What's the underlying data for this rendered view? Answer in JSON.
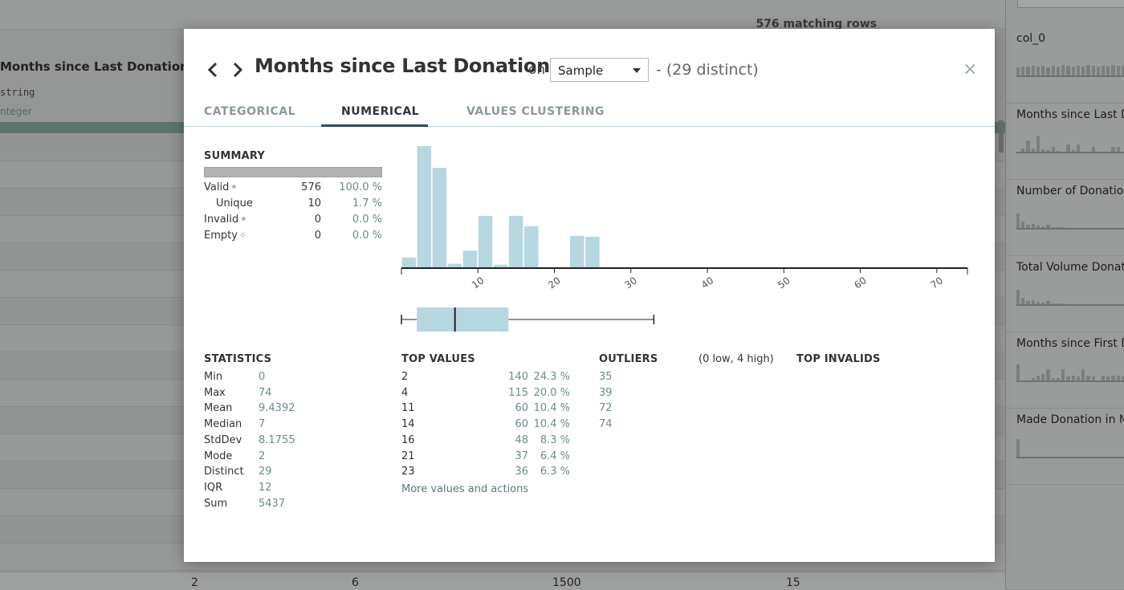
{
  "background": {
    "matching_rows": "576 matching rows",
    "column_header": "Months since Last Donation",
    "storage_type": "string",
    "meaning_type": "nteger",
    "bottom_row": [
      "2",
      "6",
      "1500",
      "15"
    ]
  },
  "side_panel": {
    "items": [
      {
        "label": "col_0",
        "bars": [
          10,
          11,
          11,
          12,
          11,
          12,
          10,
          12,
          11,
          13,
          12,
          11,
          12,
          11,
          13,
          12,
          11,
          12,
          11,
          13,
          12,
          12
        ]
      },
      {
        "label": "Months since Last D",
        "bars": [
          0,
          4,
          14,
          4,
          20,
          3,
          2,
          6,
          1,
          0,
          9,
          2,
          9,
          0,
          0,
          6,
          0,
          0,
          0,
          6,
          6,
          0
        ]
      },
      {
        "label": "Number of Donation",
        "bars": [
          18,
          8,
          4,
          5,
          3,
          2,
          4,
          1,
          1,
          1,
          0,
          0,
          0,
          0,
          0,
          0,
          0,
          0,
          0,
          0,
          0,
          0
        ]
      },
      {
        "label": "Total Volume Donate",
        "bars": [
          18,
          8,
          4,
          5,
          3,
          2,
          4,
          1,
          1,
          1,
          0,
          0,
          0,
          0,
          0,
          0,
          0,
          0,
          0,
          0,
          0,
          0
        ]
      },
      {
        "label": "Months since First D",
        "bars": [
          20,
          0,
          0,
          3,
          6,
          8,
          14,
          3,
          3,
          14,
          5,
          6,
          5,
          14,
          6,
          5,
          0,
          6,
          5,
          6,
          6,
          5
        ]
      },
      {
        "label": "Made Donation in M",
        "bars": [
          22,
          0,
          0,
          0,
          0,
          0,
          0,
          0,
          0,
          0,
          0,
          0,
          0,
          0,
          0,
          0,
          0,
          0,
          0,
          0,
          0,
          0
        ]
      }
    ]
  },
  "modal": {
    "title": "Months since Last Donation",
    "on_label": "on",
    "sample_value": "Sample",
    "distinct_text": "- (29 distinct)",
    "close_symbol": "×",
    "tabs": [
      "CATEGORICAL",
      "NUMERICAL",
      "VALUES CLUSTERING"
    ],
    "active_tab": "NUMERICAL",
    "summary": {
      "title": "SUMMARY",
      "rows": [
        {
          "label": "Valid",
          "count": "576",
          "pct": "100.0 %",
          "dot": "filled"
        },
        {
          "label": "Unique",
          "count": "10",
          "pct": "1.7 %",
          "dot": "none"
        },
        {
          "label": "Invalid",
          "count": "0",
          "pct": "0.0 %",
          "dot": "filled"
        },
        {
          "label": "Empty",
          "count": "0",
          "pct": "0.0 %",
          "dot": "ring"
        }
      ]
    },
    "statistics": {
      "title": "STATISTICS",
      "rows": [
        {
          "label": "Min",
          "value": "0"
        },
        {
          "label": "Max",
          "value": "74"
        },
        {
          "label": "Mean",
          "value": "9.4392"
        },
        {
          "label": "Median",
          "value": "7"
        },
        {
          "label": "StdDev",
          "value": "8.1755"
        },
        {
          "label": "Mode",
          "value": "2"
        },
        {
          "label": "Distinct",
          "value": "29"
        },
        {
          "label": "IQR",
          "value": "12"
        },
        {
          "label": "Sum",
          "value": "5437"
        }
      ]
    },
    "top_values": {
      "title": "TOP VALUES",
      "rows": [
        {
          "value": "2",
          "count": "140",
          "pct": "24.3 %"
        },
        {
          "value": "4",
          "count": "115",
          "pct": "20.0 %"
        },
        {
          "value": "11",
          "count": "60",
          "pct": "10.4 %"
        },
        {
          "value": "14",
          "count": "60",
          "pct": "10.4 %"
        },
        {
          "value": "16",
          "count": "48",
          "pct": "8.3 %"
        },
        {
          "value": "21",
          "count": "37",
          "pct": "6.4 %"
        },
        {
          "value": "23",
          "count": "36",
          "pct": "6.3 %"
        }
      ],
      "more_link": "More values and actions"
    },
    "outliers": {
      "title": "OUTLIERS",
      "info": "(0 low, 4 high)",
      "values": [
        "35",
        "39",
        "72",
        "74"
      ]
    },
    "top_invalids": {
      "title": "TOP INVALIDS"
    }
  },
  "chart_data": {
    "type": "bar",
    "bar_color": "#b7d7e0",
    "x_range": [
      0,
      74
    ],
    "x_ticks": [
      10,
      20,
      30,
      40,
      50,
      60,
      70
    ],
    "bin_width": 2,
    "bins": [
      {
        "x0": 0,
        "x1": 2,
        "count": 12
      },
      {
        "x0": 2,
        "x1": 4,
        "count": 140
      },
      {
        "x0": 4,
        "x1": 6,
        "count": 115
      },
      {
        "x0": 6,
        "x1": 8,
        "count": 5
      },
      {
        "x0": 8,
        "x1": 10,
        "count": 20
      },
      {
        "x0": 10,
        "x1": 12,
        "count": 60
      },
      {
        "x0": 12,
        "x1": 14,
        "count": 4
      },
      {
        "x0": 14,
        "x1": 16,
        "count": 60
      },
      {
        "x0": 16,
        "x1": 18,
        "count": 48
      },
      {
        "x0": 18,
        "x1": 20,
        "count": 1
      },
      {
        "x0": 20,
        "x1": 22,
        "count": 0
      },
      {
        "x0": 22,
        "x1": 24,
        "count": 37
      },
      {
        "x0": 24,
        "x1": 26,
        "count": 36
      }
    ],
    "boxplot": {
      "whisker_low": 0,
      "q1": 2,
      "median": 7,
      "q3": 14,
      "whisker_high": 33
    }
  }
}
